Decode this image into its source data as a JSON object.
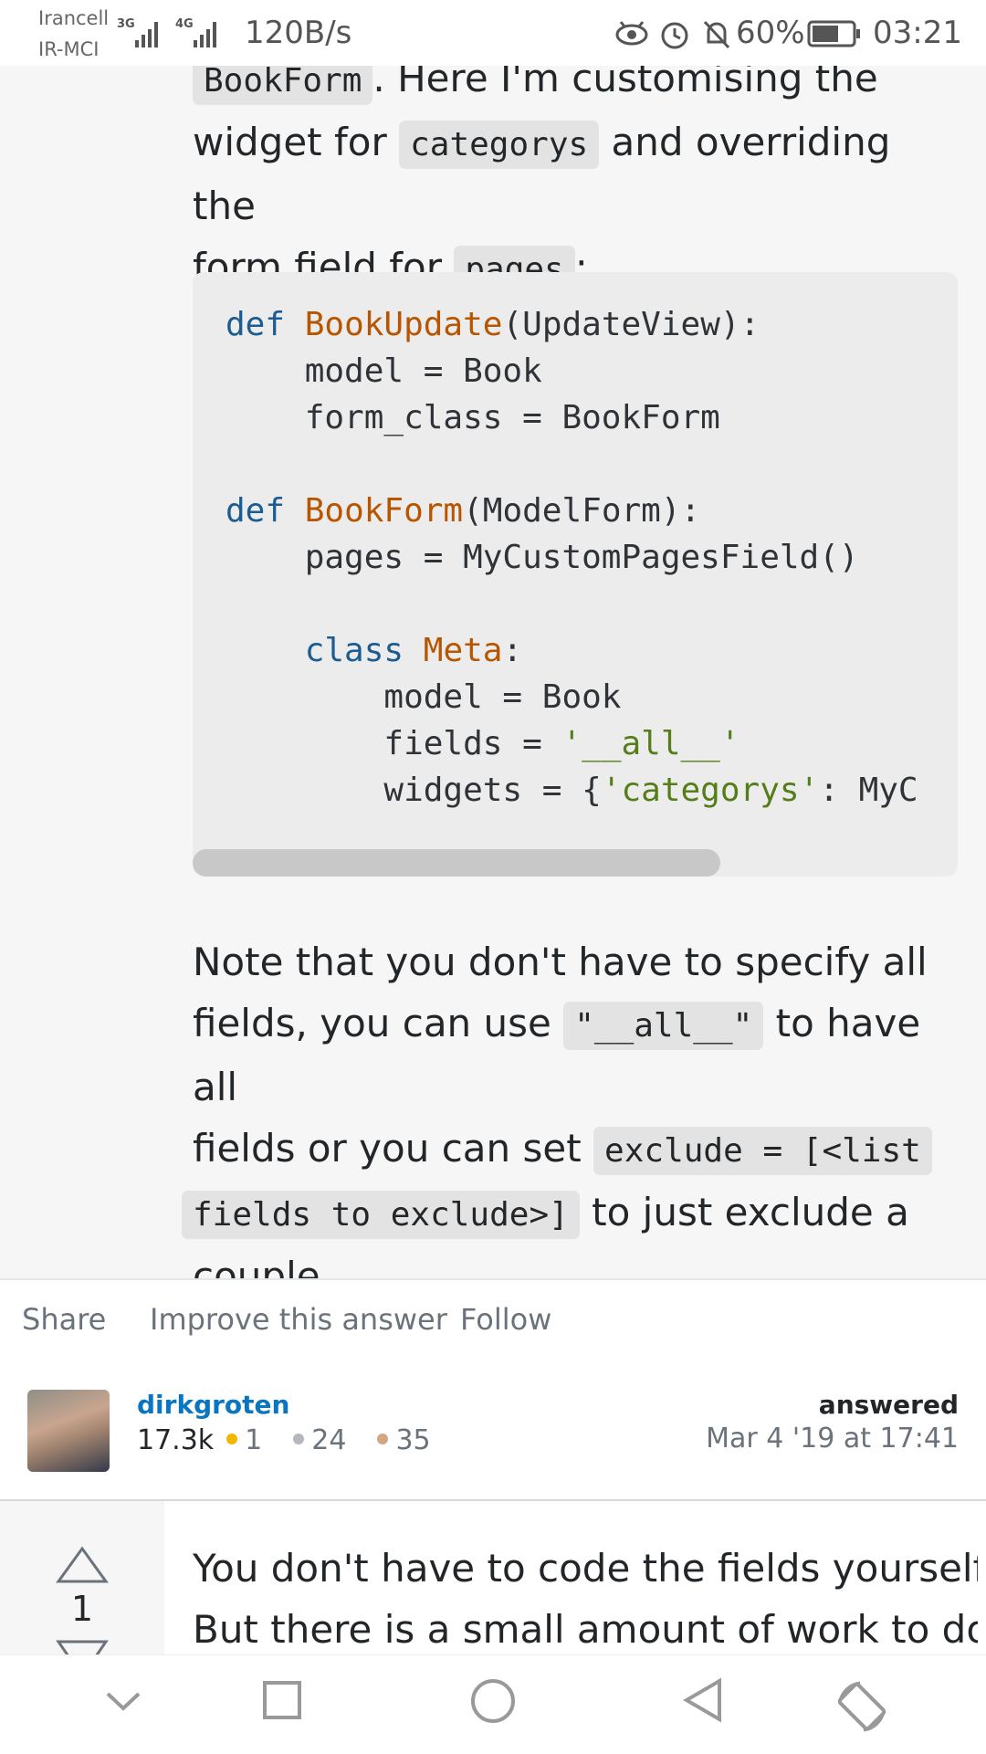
{
  "status_bar": {
    "carrier_top": "Irancell",
    "carrier_bottom": "IR-MCI",
    "network_1": "3G",
    "network_2": "4G",
    "speed": "120B/s",
    "battery": "60%",
    "time": "03:21",
    "icons": [
      "eye-icon",
      "alarm-icon",
      "bell-off-icon",
      "battery-icon"
    ]
  },
  "post": {
    "intro_lines": {
      "line1_code": "BookForm",
      "line1_text": ". Here I'm customising the",
      "line2_pre": "widget for",
      "line2_code": "categorys",
      "line2_post": "and overriding the",
      "line3_pre": "form field for",
      "line3_code": "pages",
      "line3_post": ":"
    },
    "code": {
      "l1_kw": "def",
      "l1_fn": "BookUpdate",
      "l1_rest": "(UpdateView):",
      "l2": "    model = Book",
      "l3": "    form_class = BookForm",
      "l5_kw": "def",
      "l5_fn": "BookForm",
      "l5_rest": "(ModelForm):",
      "l6": "    pages = MyCustomPagesField()",
      "l8_kw": "    class",
      "l8_fn": "Meta",
      "l8_rest": ":",
      "l9": "        model = Book",
      "l10_pre": "        fields = ",
      "l10_str": "'__all__'",
      "l11_pre": "        widgets = {",
      "l11_str": "'categorys'",
      "l11_post": ": MyC"
    },
    "note": {
      "p1": "Note that you don't have to specify all",
      "p2_pre": "fields, you can use",
      "p2_code": "\"__all__\"",
      "p2_post": "to have all",
      "p3_pre": "fields or you can set",
      "p3_code": "exclude = [<list",
      "p4_code": "fields to exclude>]",
      "p4_post": "to just exclude a",
      "p5": "couple."
    }
  },
  "actions": {
    "share": "Share",
    "improve": "Improve this answer",
    "follow": "Follow"
  },
  "author": {
    "name": "dirkgroten",
    "reputation": "17.3k",
    "gold": "1",
    "silver": "24",
    "bronze": "35",
    "answered_label": "answered",
    "answered_date": "Mar 4 '19 at 17:41",
    "colors": {
      "gold": "#f1b600",
      "silver": "#b4b8bc",
      "bronze": "#d1a684"
    }
  },
  "next_answer": {
    "vote_count": "1",
    "line1": "You don't have to code the fields yourself.",
    "line2": "But there is a small amount of work to do,"
  },
  "nav_bar": {
    "icons": [
      "chevron-down-icon",
      "square-icon",
      "circle-icon",
      "back-triangle-icon",
      "rotate-icon"
    ]
  }
}
